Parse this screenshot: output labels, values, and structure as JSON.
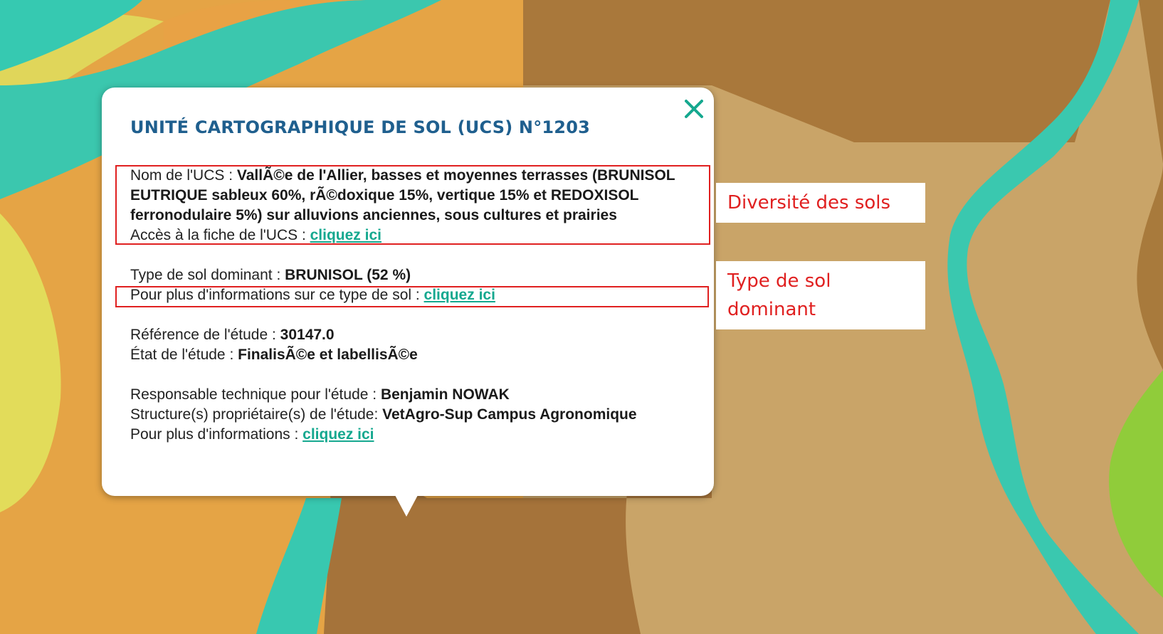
{
  "popup": {
    "title": "UNITÉ CARTOGRAPHIQUE DE SOL (UCS) N°1203",
    "ucs_name_label": "Nom de l'UCS : ",
    "ucs_name_value": "VallÃ©e de l'Allier, basses et moyennes terrasses (BRUNISOL EUTRIQUE sableux 60%, rÃ©doxique 15%, vertique 15% et REDOXISOL ferronodulaire 5%) sur alluvions anciennes, sous cultures et prairies",
    "ucs_sheet_label": "Accès à la fiche de l'UCS : ",
    "dominant_label": "Type de sol dominant : ",
    "dominant_value": "BRUNISOL (52 %)",
    "soil_info_label": "Pour plus d'informations sur ce type de sol : ",
    "study_ref_label": "Référence de l'étude : ",
    "study_ref_value": "30147.0",
    "study_state_label": "État de l'étude : ",
    "study_state_value": "FinalisÃ©e et labellisÃ©e",
    "tech_lead_label": "Responsable technique pour l'étude : ",
    "tech_lead_value": "Benjamin NOWAK",
    "owner_label": "Structure(s) propriétaire(s) de l'étude: ",
    "owner_value": "VetAgro-Sup Campus Agronomique",
    "more_info_label": "Pour plus d'informations : ",
    "link_label": "cliquez ici",
    "close_icon": "close-icon"
  },
  "annotations": {
    "diversity": "Diversité des sols",
    "dominant": "Type de sol dominant"
  },
  "colors": {
    "title": "#1f5f8e",
    "link": "#15a88f",
    "highlight": "#e02020",
    "map_turquoise": "#33c9b0",
    "map_brown": "#a8763a",
    "map_tan": "#c9a468",
    "map_yellow": "#e6dd5a",
    "map_orange": "#e8a642"
  }
}
